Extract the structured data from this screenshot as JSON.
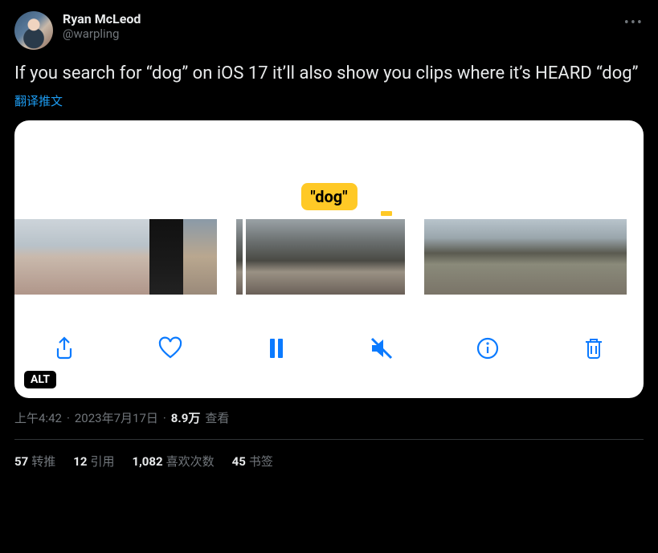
{
  "author": {
    "display_name": "Ryan McLeod",
    "handle": "@warpling"
  },
  "body": "If you search for “dog” on iOS 17 it’ll also show you clips where it’s HEARD “dog”",
  "translate_label": "翻译推文",
  "media": {
    "caption_chip": "\"dog\"",
    "alt_badge": "ALT",
    "toolbar": {
      "share": "share",
      "like": "like",
      "pause": "pause",
      "mute": "mute",
      "info": "info",
      "trash": "trash"
    }
  },
  "meta": {
    "time": "上午4:42",
    "dot1": "·",
    "date": "2023年7月17日",
    "dot2": "·",
    "views_number": "8.9万",
    "views_label": "查看"
  },
  "stats": {
    "retweets": {
      "n": "57",
      "label": "转推"
    },
    "quotes": {
      "n": "12",
      "label": "引用"
    },
    "likes": {
      "n": "1,082",
      "label": "喜欢次数"
    },
    "bookmarks": {
      "n": "45",
      "label": "书签"
    }
  }
}
